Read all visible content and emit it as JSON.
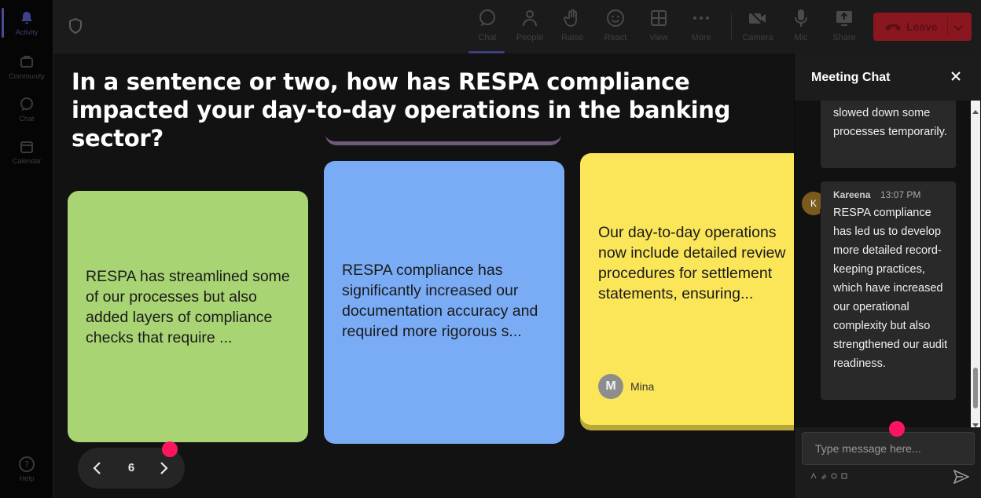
{
  "rail": {
    "items": [
      {
        "label": "Activity",
        "icon": "bell-icon"
      },
      {
        "label": "Community",
        "icon": "community-icon"
      },
      {
        "label": "Chat",
        "icon": "chat-bubble-icon"
      },
      {
        "label": "Calendar",
        "icon": "calendar-icon"
      },
      {
        "label": "Help",
        "icon": "help-icon"
      }
    ]
  },
  "toolbar": {
    "chat": "Chat",
    "people": "People",
    "raise": "Raise",
    "react": "React",
    "view": "View",
    "more": "More",
    "camera": "Camera",
    "mic": "Mic",
    "share": "Share",
    "leave": "Leave"
  },
  "stage": {
    "question": "In a sentence or two, how has RESPA compliance impacted your day-to-day operations in the banking sector?",
    "cards": [
      {
        "text": "RESPA has streamlined some of our processes but also added layers of compliance checks that require ...",
        "color": "#a8d473"
      },
      {
        "text": "RESPA compliance has significantly increased our documentation accuracy and required more rigorous s...",
        "color": "#7aacf6"
      },
      {
        "text": "Our day-to-day operations now include detailed review procedures for settlement statements, ensuring...",
        "color": "#fbe65a",
        "author_initial": "M",
        "author": "Mina"
      }
    ],
    "pager": {
      "page": "6"
    }
  },
  "chat": {
    "title": "Meeting Chat",
    "messages": [
      {
        "text": "slowed down some processes temporarily."
      },
      {
        "sender": "Kareena",
        "initial": "K",
        "time": "13:07 PM",
        "text": "RESPA compliance has led us to develop more detailed record-keeping practices, which have increased our operational complexity but also strengthened our audit readiness."
      }
    ],
    "input_placeholder": "Type message here..."
  },
  "colors": {
    "leave": "#8a1620",
    "accent": "#3d3f80",
    "marker": "#ff1460"
  }
}
